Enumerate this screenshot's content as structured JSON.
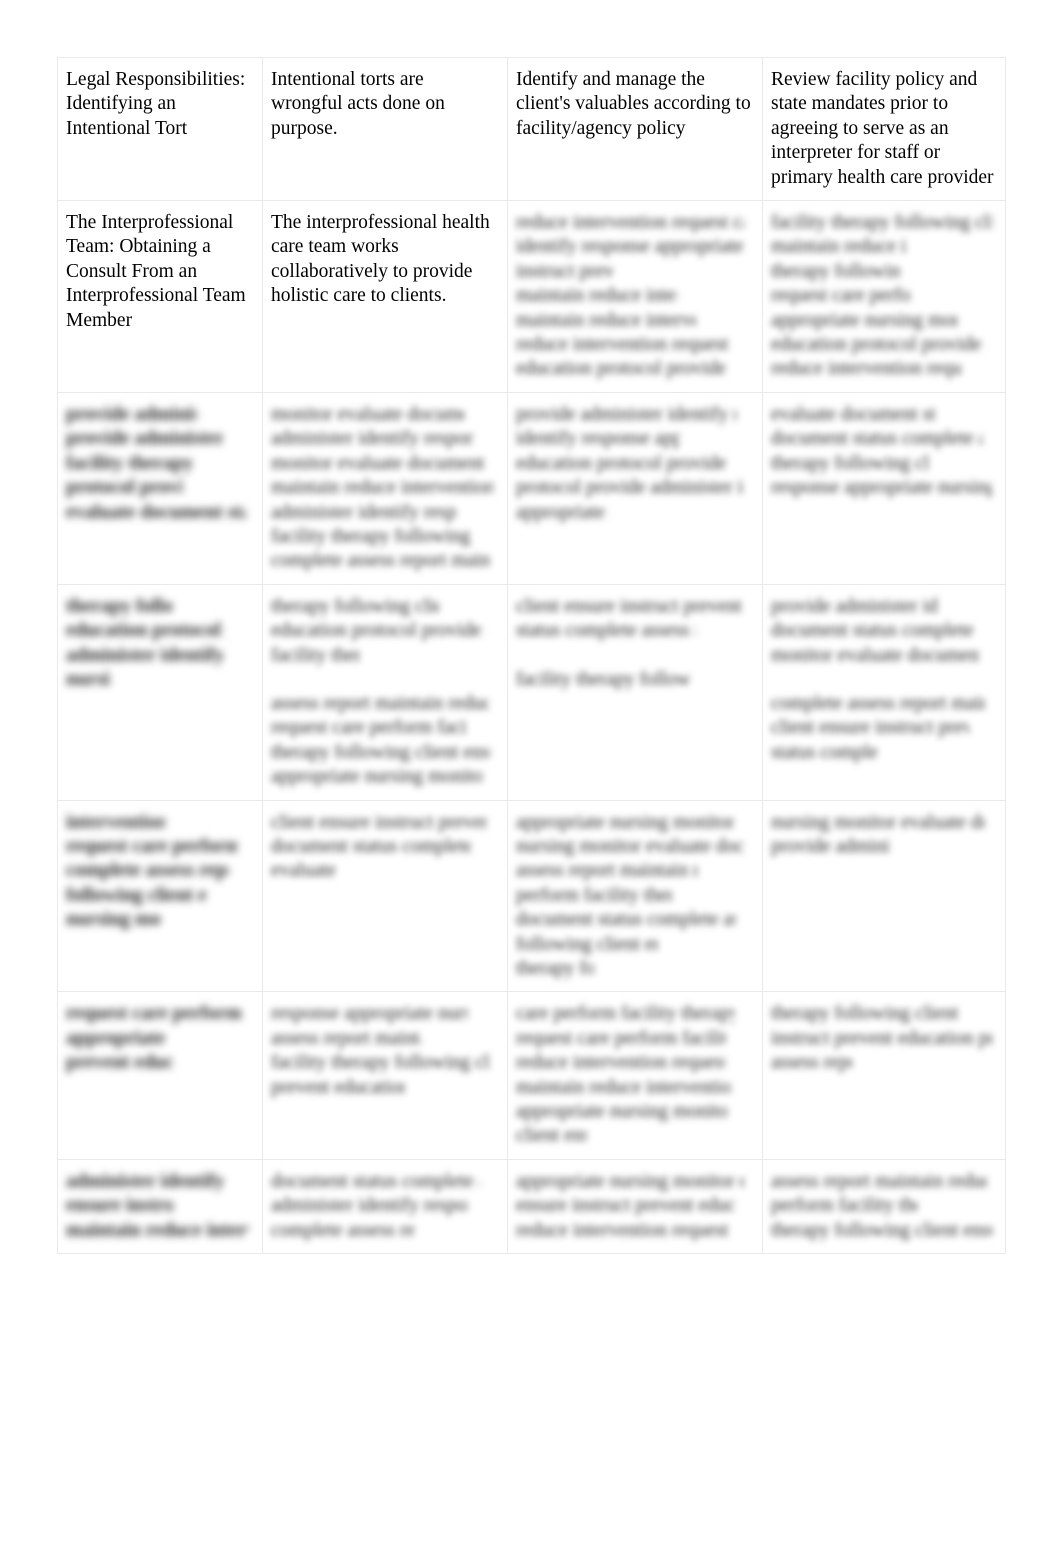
{
  "document": {
    "type": "study-notes-table",
    "page_background": "#ffffff",
    "text_color": "#000000",
    "border_color": "#e9e9e9",
    "columns": 4,
    "rows_visible": 7,
    "last_row_clipped": true
  },
  "table": {
    "rows": [
      {
        "id": "row-legal-responsibilities",
        "redacted": false,
        "cells": [
          {
            "id": "topic",
            "redacted": false,
            "paragraphs": [
              "Legal Responsibilities: Identifying an Intentional Tort"
            ]
          },
          {
            "id": "note-1",
            "redacted": false,
            "paragraphs": [
              "Intentional torts are wrongful acts done on purpose."
            ]
          },
          {
            "id": "note-2",
            "redacted": false,
            "paragraphs": [
              "Identify and manage the client's valuables according to facility/agency policy"
            ]
          },
          {
            "id": "note-3",
            "redacted": false,
            "paragraphs": [
              "Review facility policy and state mandates prior to agreeing to serve as an interpreter for staff or primary health care provider"
            ]
          }
        ]
      },
      {
        "id": "row-interprofessional-team",
        "redacted": "partial",
        "cells": [
          {
            "id": "topic",
            "redacted": false,
            "paragraphs": [
              "The Interprofessional Team: Obtaining a Consult From an Interprofessional Team Member"
            ]
          },
          {
            "id": "note-1",
            "redacted": false,
            "paragraphs": [
              "The interprofessional health care team works collaboratively to provide holistic care to clients."
            ]
          },
          {
            "id": "note-2",
            "redacted": true,
            "line_widths": [
              [
                96
              ],
              [
                97
              ],
              [
                41
              ],
              [
                68
              ],
              [
                76
              ],
              [
                92
              ],
              [
                88
              ]
            ]
          },
          {
            "id": "note-3",
            "redacted": true,
            "line_widths": [
              [
                98
              ],
              [
                60
              ],
              [
                57
              ],
              [
                62
              ],
              [
                83
              ],
              [
                96
              ],
              [
                85
              ]
            ]
          }
        ]
      },
      {
        "id": "row-infection-control",
        "redacted": true,
        "cells": [
          {
            "id": "topic",
            "redacted": true,
            "bold": true,
            "line_widths": [
              [
                70
              ],
              [
                84
              ],
              [
                68
              ],
              [
                62
              ],
              [
                96
              ]
            ]
          },
          {
            "id": "note-1",
            "redacted": true,
            "line_widths": [
              [
                85
              ],
              [
                89
              ],
              [
                95
              ],
              [
                98
              ],
              [
                82
              ],
              [
                88
              ],
              [
                96
              ]
            ]
          },
          {
            "id": "note-2",
            "redacted": true,
            "line_widths": [
              [
                93
              ],
              [
                69
              ],
              [
                90
              ],
              [
                96
              ],
              [
                40
              ]
            ]
          },
          {
            "id": "note-3",
            "redacted": true,
            "line_widths": [
              [
                73
              ],
              [
                94
              ],
              [
                70
              ],
              [
                98
              ]
            ]
          }
        ]
      },
      {
        "id": "row-medical-surgical",
        "redacted": true,
        "cells": [
          {
            "id": "topic",
            "redacted": true,
            "bold": true,
            "line_widths": [
              [
                57
              ],
              [
                86
              ],
              [
                84
              ],
              [
                24
              ]
            ]
          },
          {
            "id": "note-1",
            "redacted": true,
            "paragraph_line_widths": [
              [
                [
                  74
                ],
                [
                  95
                ],
                [
                  39
                ]
              ],
              [
                [
                  96
                ],
                [
                  86
                ],
                [
                  97
                ],
                [
                  93
                ]
              ]
            ]
          },
          {
            "id": "note-2",
            "redacted": true,
            "paragraph_line_widths": [
              [
                [
                  96
                ],
                [
                  76
                ]
              ],
              [
                [
                  74
                ]
              ]
            ]
          },
          {
            "id": "note-3",
            "redacted": true,
            "paragraph_line_widths": [
              [
                [
                  74
                ],
                [
                  92
                ],
                [
                  93
                ]
              ],
              [
                [
                  95
                ],
                [
                  88
                ],
                [
                  47
                ]
              ]
            ]
          }
        ]
      },
      {
        "id": "row-dosage-calculation",
        "redacted": true,
        "cells": [
          {
            "id": "topic",
            "redacted": true,
            "bold": true,
            "line_widths": [
              [
                53
              ],
              [
                92
              ],
              [
                87
              ],
              [
                75
              ],
              [
                50
              ]
            ]
          },
          {
            "id": "note-1",
            "redacted": true,
            "line_widths": [
              [
                95
              ],
              [
                88
              ],
              [
                28
              ]
            ]
          },
          {
            "id": "note-2",
            "redacted": true,
            "line_widths": [
              [
                92
              ],
              [
                96
              ],
              [
                77
              ],
              [
                66
              ],
              [
                93
              ],
              [
                60
              ],
              [
                33
              ]
            ]
          },
          {
            "id": "note-3",
            "redacted": true,
            "line_widths": [
              [
                95
              ],
              [
                53
              ]
            ]
          }
        ]
      },
      {
        "id": "row-client-safety",
        "redacted": true,
        "cells": [
          {
            "id": "topic",
            "redacted": true,
            "bold": true,
            "line_widths": [
              [
                97
              ],
              [
                53
              ],
              [
                58
              ]
            ]
          },
          {
            "id": "note-1",
            "redacted": true,
            "line_widths": [
              [
                87
              ],
              [
                66
              ],
              [
                97
              ],
              [
                59
              ]
            ]
          },
          {
            "id": "note-2",
            "redacted": true,
            "line_widths": [
              [
                92
              ],
              [
                88
              ],
              [
                88
              ],
              [
                91
              ],
              [
                89
              ],
              [
                30
              ]
            ]
          },
          {
            "id": "note-3",
            "redacted": true,
            "line_widths": [
              [
                83
              ],
              [
                98
              ],
              [
                36
              ]
            ]
          }
        ]
      },
      {
        "id": "row-health-promotion",
        "redacted": true,
        "clipped": true,
        "cells": [
          {
            "id": "topic",
            "redacted": true,
            "bold": true,
            "line_widths": [
              [
                87
              ],
              [
                57
              ],
              [
                98
              ]
            ]
          },
          {
            "id": "note-1",
            "redacted": true,
            "line_widths": [
              [
                92
              ],
              [
                87
              ],
              [
                63
              ]
            ]
          },
          {
            "id": "note-2",
            "redacted": true,
            "line_widths": [
              [
                96
              ],
              [
                93
              ],
              [
                90
              ]
            ]
          },
          {
            "id": "note-3",
            "redacted": true,
            "line_widths": [
              [
                96
              ],
              [
                65
              ],
              [
                98
              ]
            ]
          }
        ]
      }
    ]
  }
}
